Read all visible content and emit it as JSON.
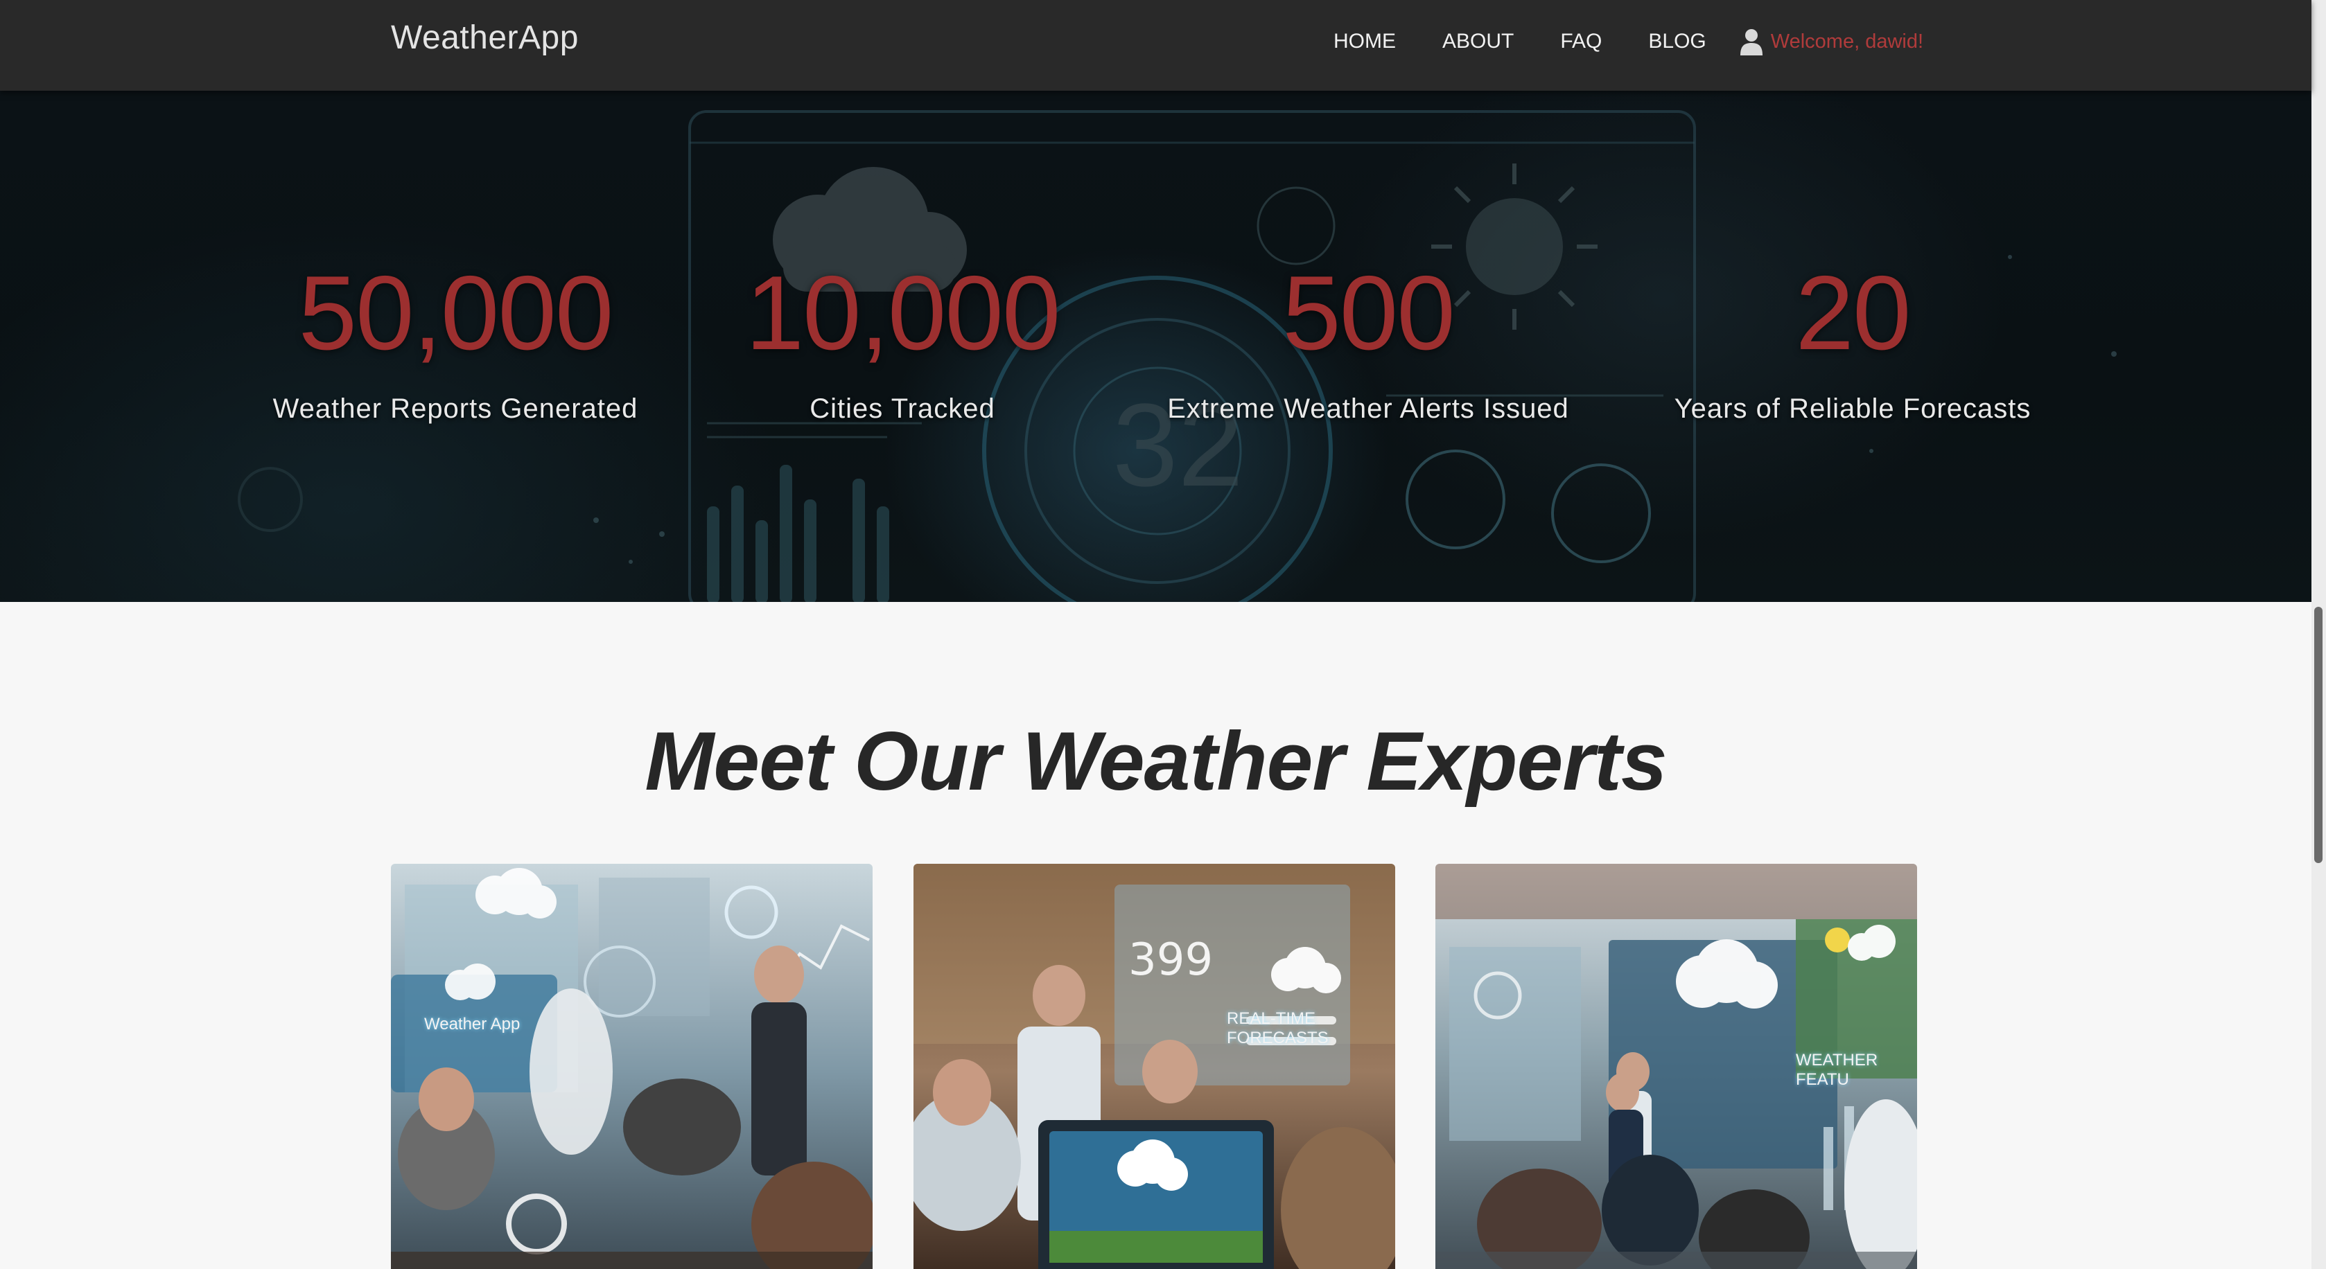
{
  "navbar": {
    "brand": "WeatherApp",
    "links": [
      "HOME",
      "ABOUT",
      "FAQ",
      "BLOG"
    ],
    "user_icon": "user-icon",
    "welcome": "Welcome, dawid!"
  },
  "hero": {
    "stats": [
      {
        "number": "50,000",
        "label": "Weather Reports Generated"
      },
      {
        "number": "10,000",
        "label": "Cities Tracked"
      },
      {
        "number": "500",
        "label": "Extreme Weather Alerts Issued"
      },
      {
        "number": "20",
        "label": "Years of Reliable Forecasts"
      }
    ]
  },
  "experts": {
    "title": "Meet Our Weather Experts",
    "cards": [
      {
        "caption": "Weather App"
      },
      {
        "caption": "REAL-TIME FORECASTS"
      },
      {
        "caption": "WEATHER FEATU"
      }
    ]
  },
  "colors": {
    "accent": "#9c2f2f",
    "navbar": "#292929",
    "hero": "#0b1216",
    "title": "#272727"
  }
}
